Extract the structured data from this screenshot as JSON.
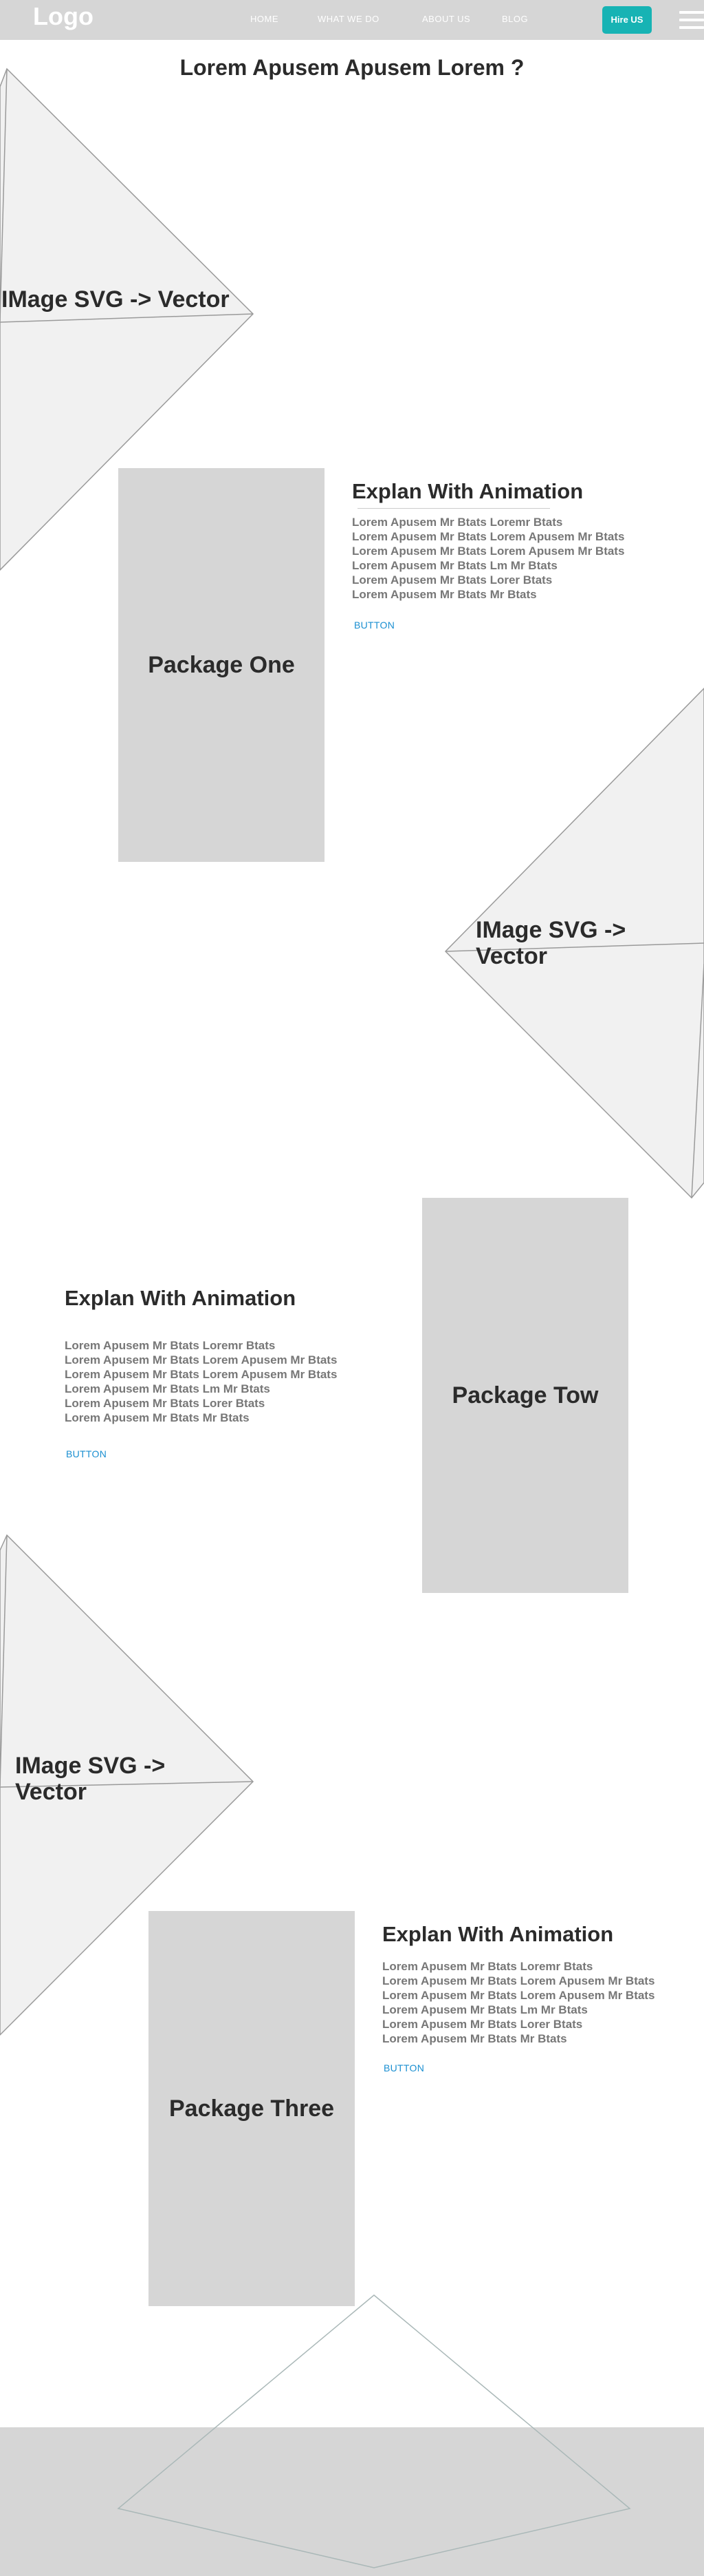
{
  "header": {
    "logo": "Logo",
    "nav": [
      "HOME",
      "WHAT WE DO",
      "ABOUT US",
      "BLOG"
    ],
    "hire_label": "Hire US",
    "menu_icon": "hamburger-icon"
  },
  "page_title": "Lorem Apusem Apusem Lorem ?",
  "image_labels": {
    "one": "IMage SVG -> Vector",
    "two": "IMage SVG -> Vector",
    "three": "IMage SVG -> Vector"
  },
  "packages": [
    "Package One",
    "Package Tow",
    "Package Three"
  ],
  "sections": [
    {
      "title": "Explan With Animation",
      "lines": [
        " Lorem Apusem Mr Btats Loremr Btats",
        "Lorem Apusem Mr Btats Lorem Apusem Mr Btats",
        "Lorem Apusem Mr Btats Lorem Apusem Mr Btats",
        "Lorem Apusem Mr Btats Lm Mr Btats",
        "Lorem Apusem Mr Btats Lorer Btats",
        "Lorem Apusem Mr Btats Mr Btats"
      ],
      "button": "BUTTON"
    },
    {
      "title": "Explan With Animation",
      "lines": [
        " Lorem Apusem Mr Btats Loremr Btats",
        "Lorem Apusem Mr Btats Lorem Apusem Mr Btats",
        "Lorem Apusem Mr Btats Lorem Apusem Mr Btats",
        "Lorem Apusem Mr Btats Lm Mr Btats",
        "Lorem Apusem Mr Btats Lorer Btats",
        "Lorem Apusem Mr Btats Mr Btats"
      ],
      "button": "BUTTON"
    },
    {
      "title": "Explan With Animation",
      "lines": [
        " Lorem Apusem Mr Btats Loremr Btats",
        "Lorem Apusem Mr Btats Lorem Apusem Mr Btats",
        "Lorem Apusem Mr Btats Lorem Apusem Mr Btats",
        "Lorem Apusem Mr Btats Lm Mr Btats",
        "Lorem Apusem Mr Btats Lorer Btats",
        "Lorem Apusem Mr Btats Mr Btats"
      ],
      "button": "BUTTON"
    }
  ],
  "colors": {
    "header_bg": "#d6d6d6",
    "accent": "#17b3b4",
    "link": "#1a8fd1",
    "shape_fill": "#f1f1f1",
    "shape_stroke": "#9a9a9a"
  }
}
